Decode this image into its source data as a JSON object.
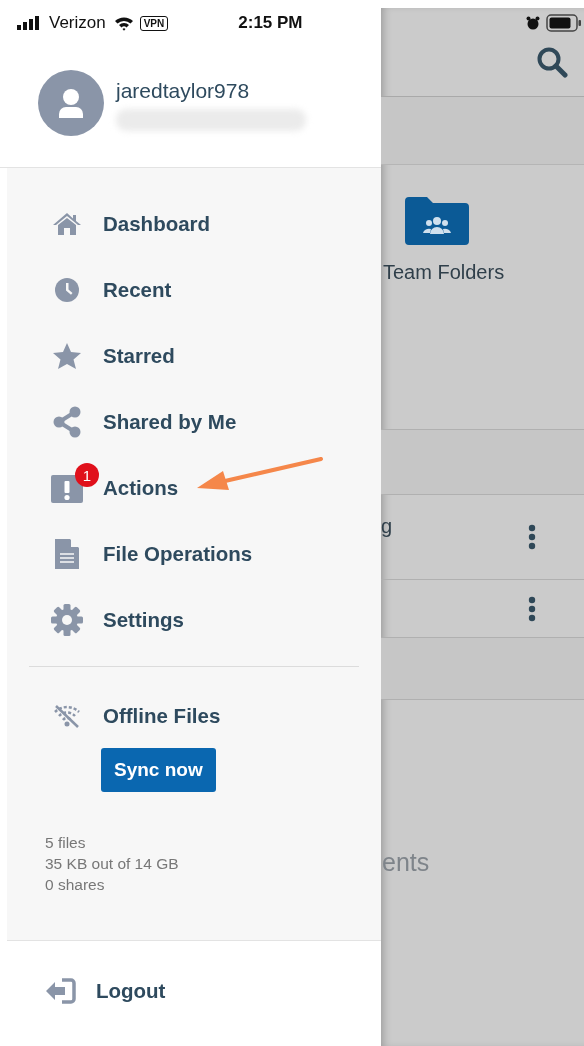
{
  "status_bar": {
    "carrier": "Verizon",
    "vpn": "VPN",
    "time": "2:15 PM"
  },
  "user": {
    "username": "jaredtaylor978"
  },
  "menu": [
    {
      "label": "Dashboard",
      "kind": "home"
    },
    {
      "label": "Recent",
      "kind": "clock"
    },
    {
      "label": "Starred",
      "kind": "star"
    },
    {
      "label": "Shared by Me",
      "kind": "share"
    },
    {
      "label": "Actions",
      "kind": "alert",
      "badge": "1"
    },
    {
      "label": "File Operations",
      "kind": "document"
    },
    {
      "label": "Settings",
      "kind": "gear"
    }
  ],
  "offline": {
    "label": "Offline Files",
    "button": "Sync now",
    "stats": [
      "5 files",
      "35 KB out of 14 GB",
      "0 shares"
    ]
  },
  "logout": {
    "label": "Logout"
  },
  "background": {
    "folder_label": "Team Folders",
    "row_text": "g",
    "section_text": "ents"
  }
}
